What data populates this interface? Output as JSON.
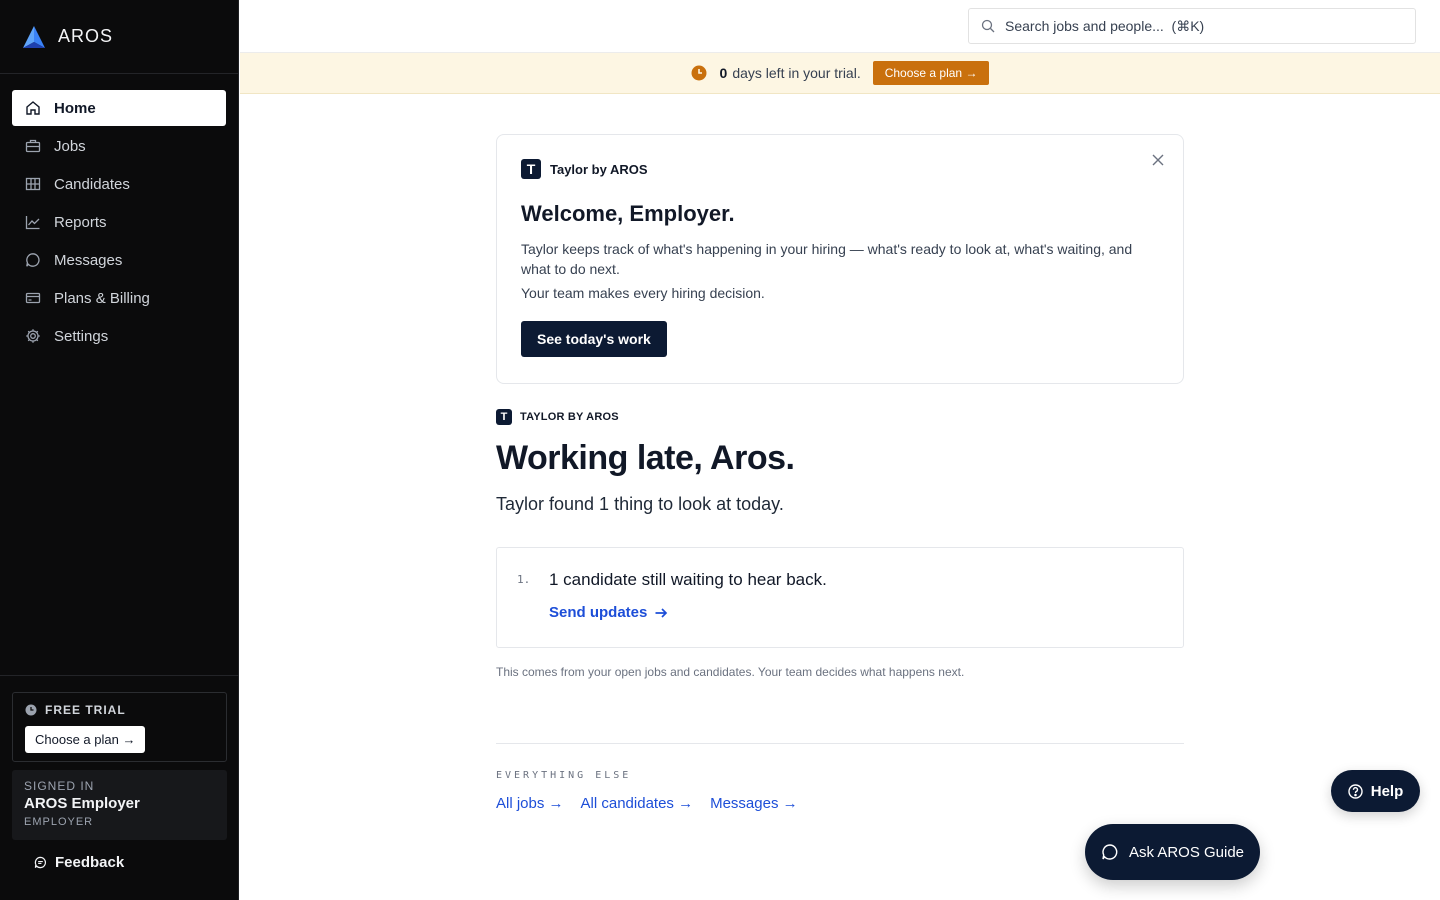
{
  "brand": {
    "name": "AROS"
  },
  "sidebar": {
    "items": [
      {
        "label": "Home",
        "icon": "home-icon",
        "active": true
      },
      {
        "label": "Jobs",
        "icon": "briefcase-icon",
        "active": false
      },
      {
        "label": "Candidates",
        "icon": "candidates-icon",
        "active": false
      },
      {
        "label": "Reports",
        "icon": "chart-icon",
        "active": false
      },
      {
        "label": "Messages",
        "icon": "chat-icon",
        "active": false
      },
      {
        "label": "Plans & Billing",
        "icon": "credit-card-icon",
        "active": false
      },
      {
        "label": "Settings",
        "icon": "gear-icon",
        "active": false
      }
    ],
    "trial": {
      "label": "FREE TRIAL",
      "button": "Choose a plan →"
    },
    "signed_in": {
      "label": "SIGNED IN",
      "name": "AROS Employer",
      "role": "EMPLOYER"
    },
    "feedback": "Feedback"
  },
  "search": {
    "placeholder": "Search jobs and people...  (⌘K)"
  },
  "banner": {
    "days": "0",
    "text": "days left in your trial.",
    "button": "Choose a plan →",
    "accent": "#c9700d"
  },
  "welcome": {
    "source": "Taylor by AROS",
    "title": "Welcome, Employer.",
    "body": "Taylor keeps track of what's happening in your hiring — what's ready to look at, what's waiting, and what to do next.",
    "body2": "Your team makes every hiring decision.",
    "button": "See today's work"
  },
  "today": {
    "tag": "TAYLOR BY AROS",
    "greeting": "Working late, Aros.",
    "summary": "Taylor found 1 thing to look at today.",
    "tasks": [
      {
        "num": "1.",
        "title": "1 candidate still waiting to hear back.",
        "link": "Send updates"
      }
    ],
    "footnote": "This comes from your open jobs and candidates. Your team decides what happens next."
  },
  "everything_else": {
    "label": "EVERYTHING ELSE",
    "links": [
      "All jobs →",
      "All candidates →",
      "Messages →"
    ]
  },
  "help": {
    "label": "Help"
  },
  "guide": {
    "label": "Ask AROS Guide"
  },
  "colors": {
    "navy": "#0c1a33",
    "link": "#1d4ed8",
    "sidebar_bg": "#0b0b0c"
  }
}
